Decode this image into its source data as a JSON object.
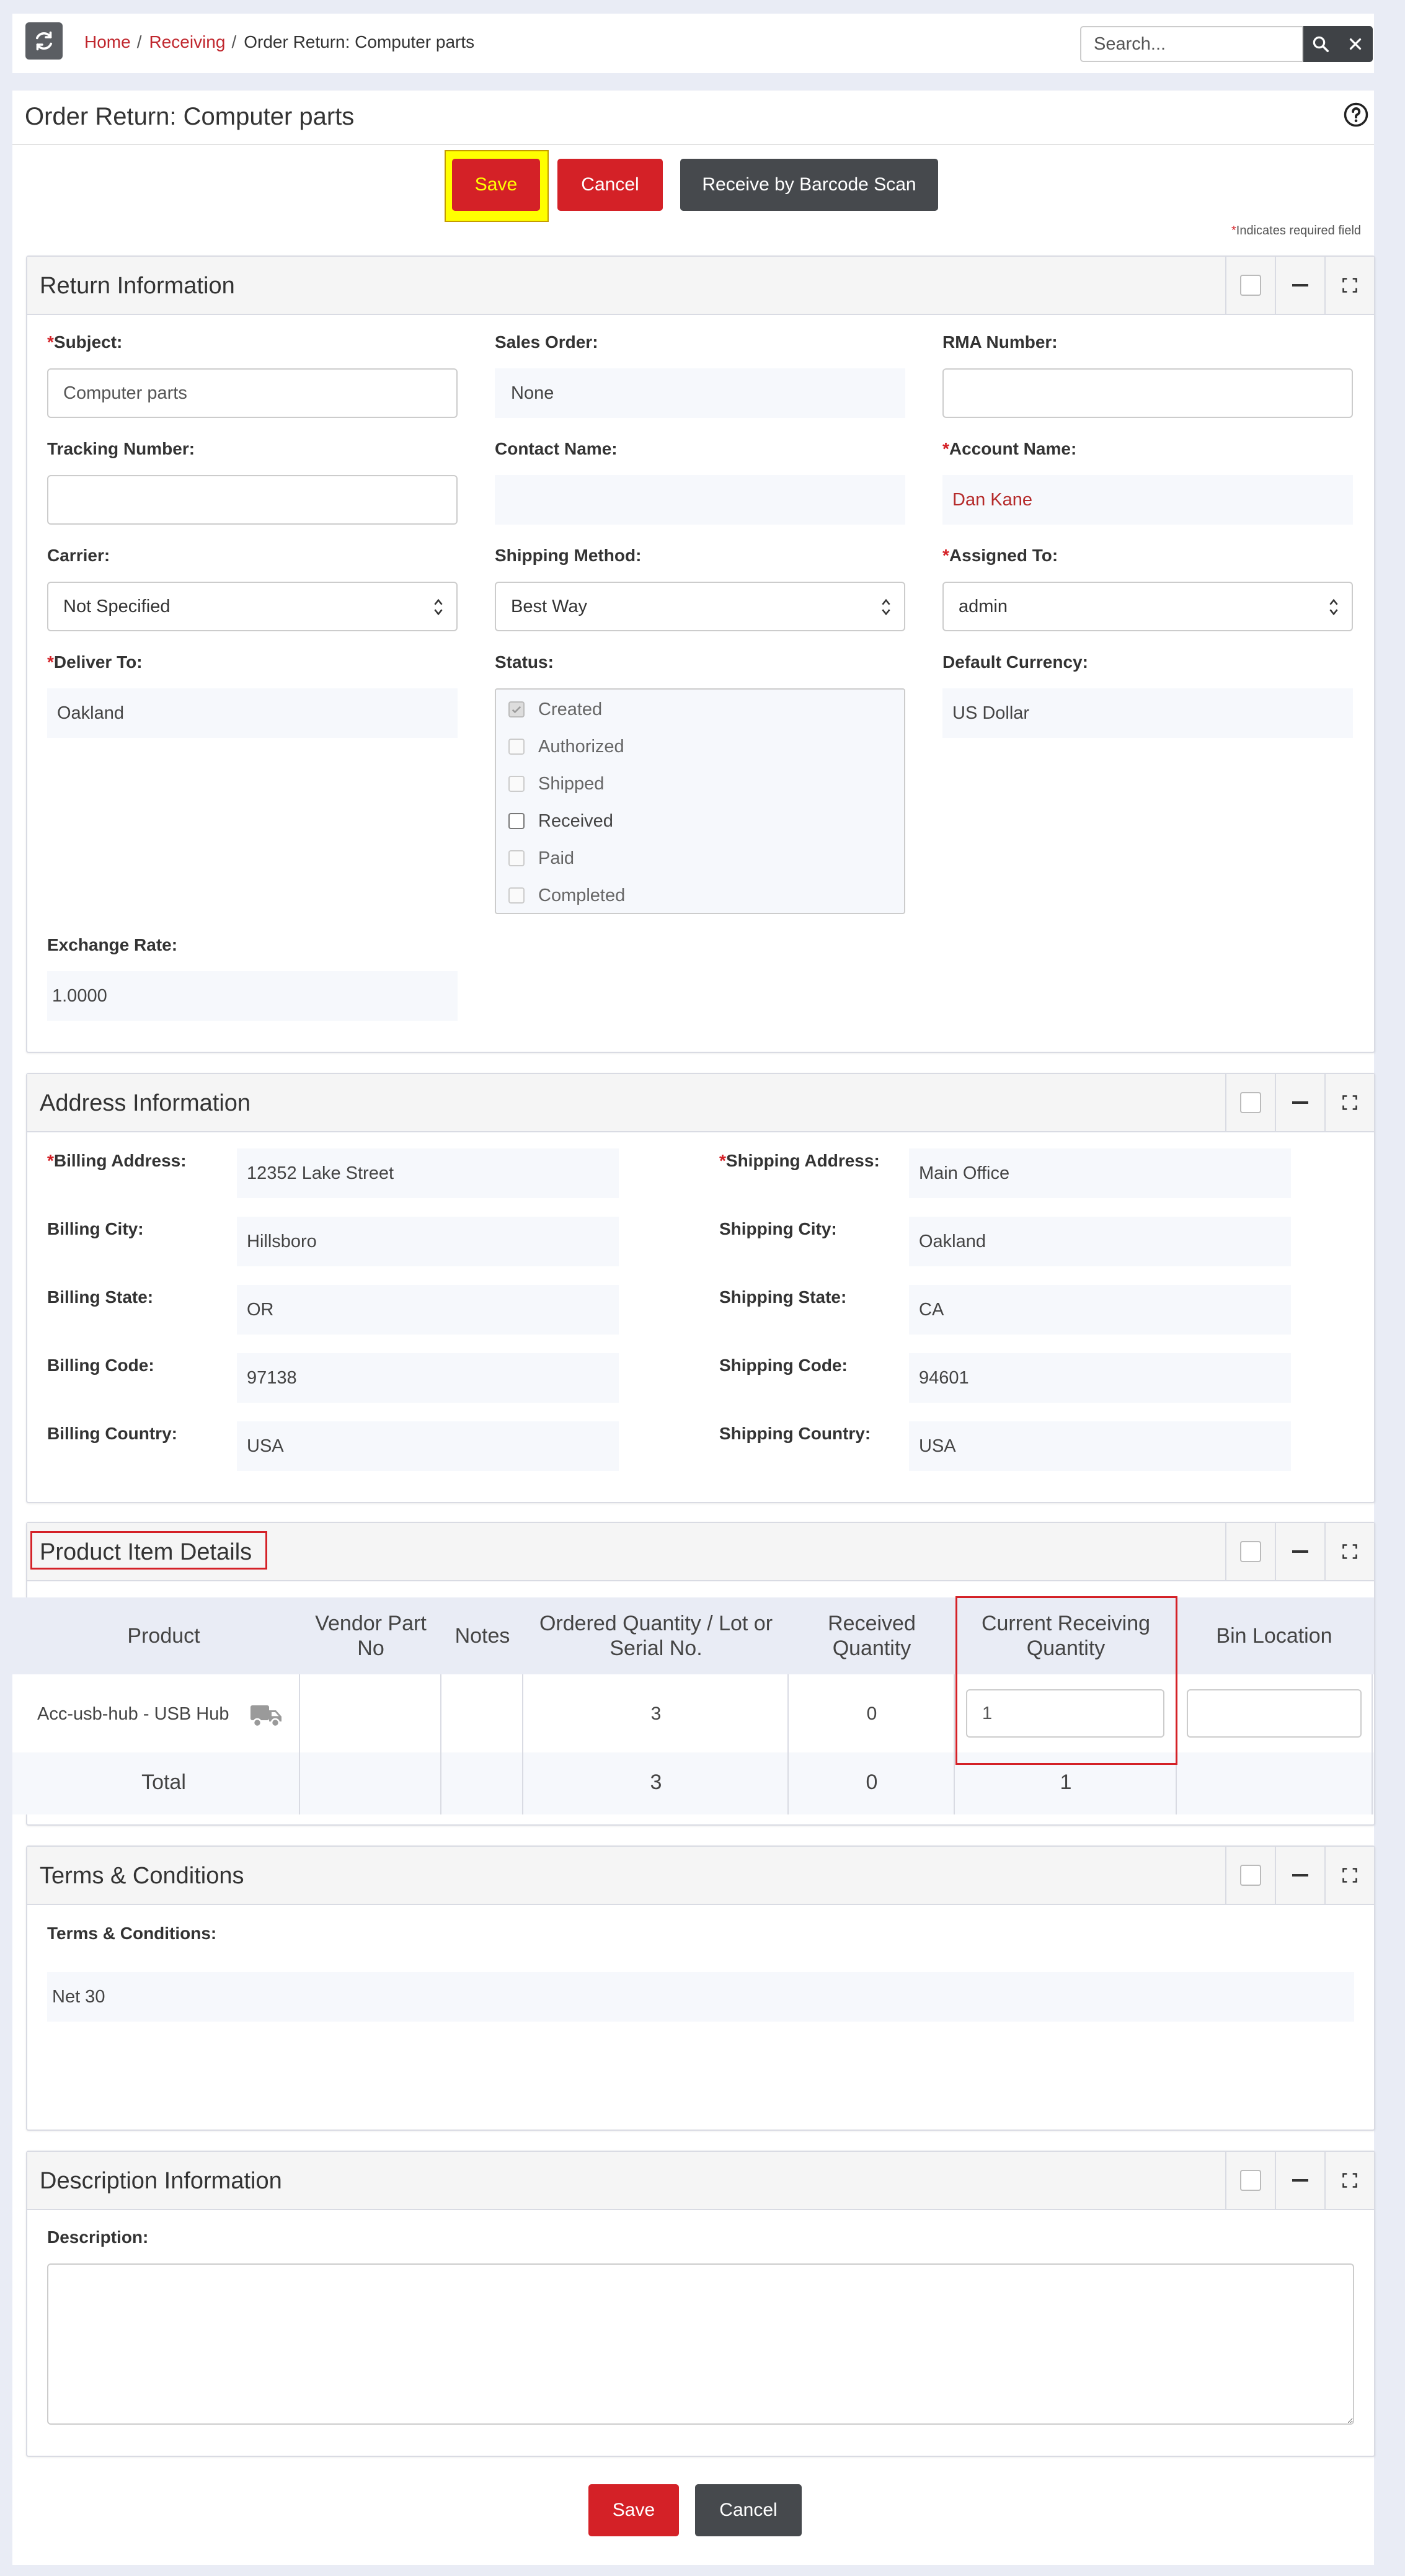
{
  "breadcrumb": {
    "home": "Home",
    "receiving": "Receiving",
    "current": "Order Return: Computer parts"
  },
  "search": {
    "placeholder": "Search..."
  },
  "page": {
    "title": "Order Return: Computer parts"
  },
  "toolbar": {
    "save_label": "Save",
    "cancel_label": "Cancel",
    "barcode_label": "Receive by Barcode Scan"
  },
  "required_note": {
    "star": "*",
    "text": "Indicates required field"
  },
  "return_info": {
    "title": "Return Information",
    "subject": {
      "label": "Subject:",
      "value": "Computer parts"
    },
    "sales_order": {
      "label": "Sales Order:",
      "value": "None"
    },
    "rma_number": {
      "label": "RMA Number:",
      "value": ""
    },
    "tracking_number": {
      "label": "Tracking Number:",
      "value": ""
    },
    "contact_name": {
      "label": "Contact Name:",
      "value": ""
    },
    "account_name": {
      "label": "Account Name:",
      "value": "Dan Kane"
    },
    "carrier": {
      "label": "Carrier:",
      "value": "Not Specified"
    },
    "shipping_method": {
      "label": "Shipping Method:",
      "value": "Best Way"
    },
    "assigned_to": {
      "label": "Assigned To:",
      "value": "admin"
    },
    "deliver_to": {
      "label": "Deliver To:",
      "value": "Oakland"
    },
    "status": {
      "label": "Status:",
      "options": [
        "Created",
        "Authorized",
        "Shipped",
        "Received",
        "Paid",
        "Completed"
      ],
      "checked": "Created",
      "enabled": "Received"
    },
    "default_currency": {
      "label": "Default Currency:",
      "value": "US Dollar"
    },
    "exchange_rate": {
      "label": "Exchange Rate:",
      "value": "1.0000"
    }
  },
  "address_info": {
    "title": "Address Information",
    "billing": [
      {
        "label": "Billing Address:",
        "value": "12352 Lake Street"
      },
      {
        "label": "Billing City:",
        "value": "Hillsboro"
      },
      {
        "label": "Billing State:",
        "value": "OR"
      },
      {
        "label": "Billing Code:",
        "value": "97138"
      },
      {
        "label": "Billing Country:",
        "value": "USA"
      }
    ],
    "shipping": [
      {
        "label": "Shipping Address:",
        "value": "Main Office"
      },
      {
        "label": "Shipping City:",
        "value": "Oakland"
      },
      {
        "label": "Shipping State:",
        "value": "CA"
      },
      {
        "label": "Shipping Code:",
        "value": "94601"
      },
      {
        "label": "Shipping Country:",
        "value": "USA"
      }
    ]
  },
  "product_items": {
    "title": "Product Item Details",
    "columns": [
      "Product",
      "Vendor Part No",
      "Notes",
      "Ordered Quantity / Lot or Serial No.",
      "Received Quantity",
      "Current Receiving Quantity",
      "Bin Location"
    ],
    "rows": [
      {
        "product": "Acc-usb-hub - USB Hub",
        "vendor_part_no": "",
        "notes": "",
        "ordered_qty": "3",
        "received_qty": "0",
        "current_receiving_qty": "1",
        "bin_location": ""
      }
    ],
    "total": {
      "label": "Total",
      "ordered_qty": "3",
      "received_qty": "0",
      "current_receiving_qty": "1"
    }
  },
  "terms": {
    "title": "Terms & Conditions",
    "label": "Terms & Conditions:",
    "value": "Net 30"
  },
  "description": {
    "title": "Description Information",
    "label": "Description:",
    "value": ""
  },
  "colors": {
    "accent_red": "#d42127",
    "dark_button": "#46494d",
    "highlight_yellow": "#ffff00",
    "link_red": "#c0262d"
  }
}
